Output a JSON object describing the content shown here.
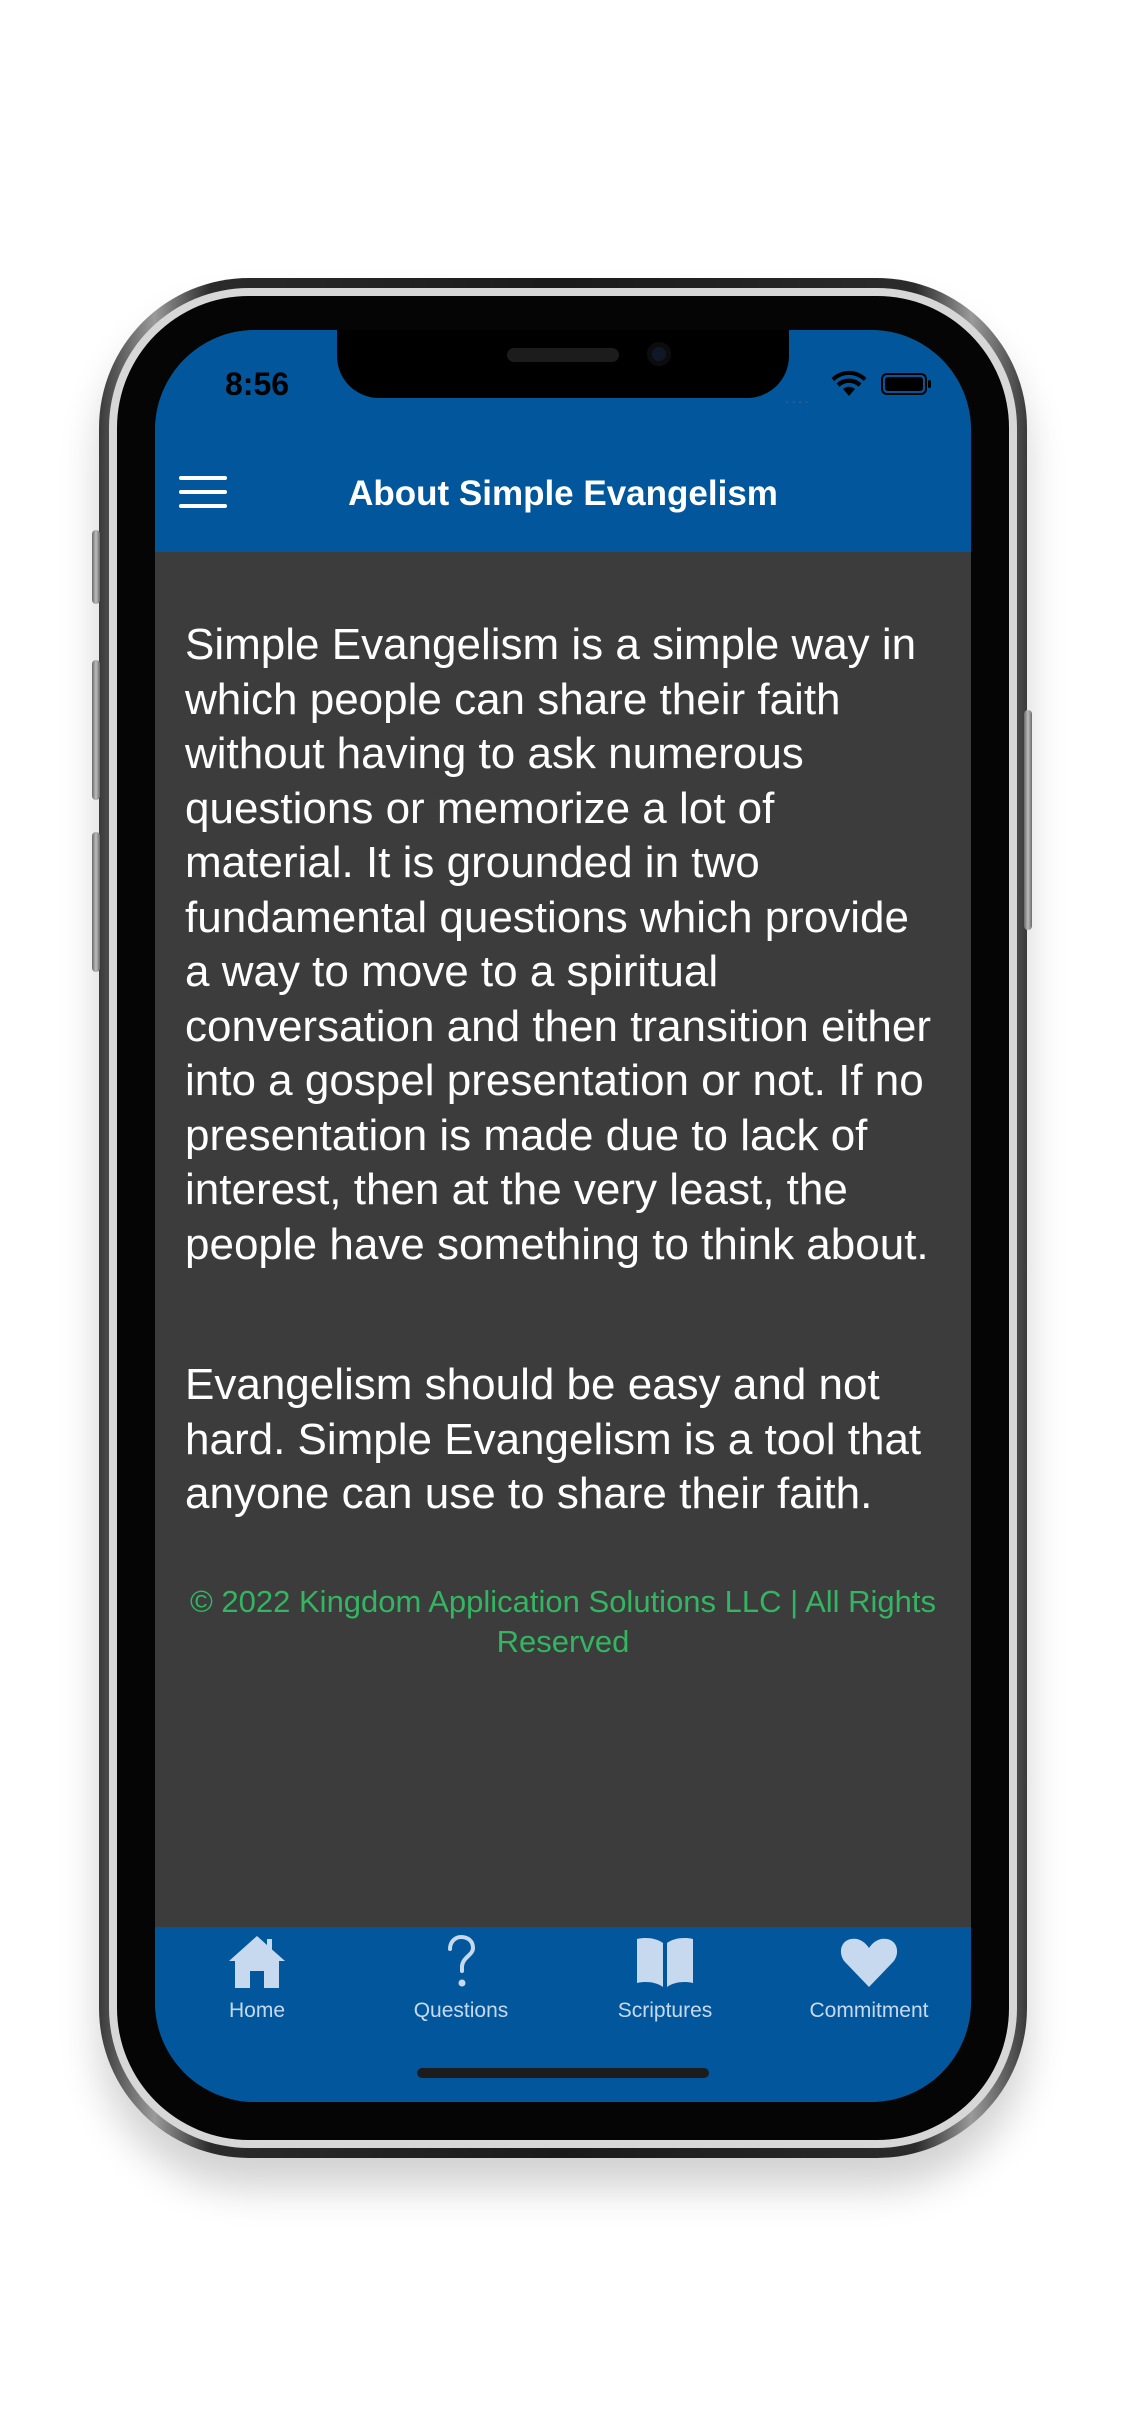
{
  "status_bar": {
    "time": "8:56",
    "signal": "....",
    "icons": [
      "wifi-icon",
      "battery-icon"
    ]
  },
  "nav": {
    "title": "About Simple Evangelism",
    "menu_icon": "hamburger-menu-icon"
  },
  "content": {
    "paragraphs": [
      "Simple Evangelism is a simple way in which people can share their faith without having to ask numerous questions or memorize a lot of material. It is grounded in two fundamental questions which provide a way to move to a spiritual conversation and then transition either into a gospel presentation or not. If no presentation is made due to lack of interest, then at the very least, the people have something to think about.",
      "Evangelism should be easy and not hard. Simple Evangelism is a tool that anyone can use to share their faith."
    ],
    "copyright": "© 2022 Kingdom Application Solutions LLC | All Rights Reserved"
  },
  "tabs": [
    {
      "label": "Home",
      "icon": "home-icon"
    },
    {
      "label": "Questions",
      "icon": "question-mark-icon"
    },
    {
      "label": "Scriptures",
      "icon": "open-book-icon"
    },
    {
      "label": "Commitment",
      "icon": "heart-icon"
    }
  ],
  "colors": {
    "brand_blue": "#02579c",
    "background": "#3c3c3c",
    "body_text": "#ffffff",
    "copyright_green": "#34b561",
    "tab_icon": "#c7d9ee"
  }
}
